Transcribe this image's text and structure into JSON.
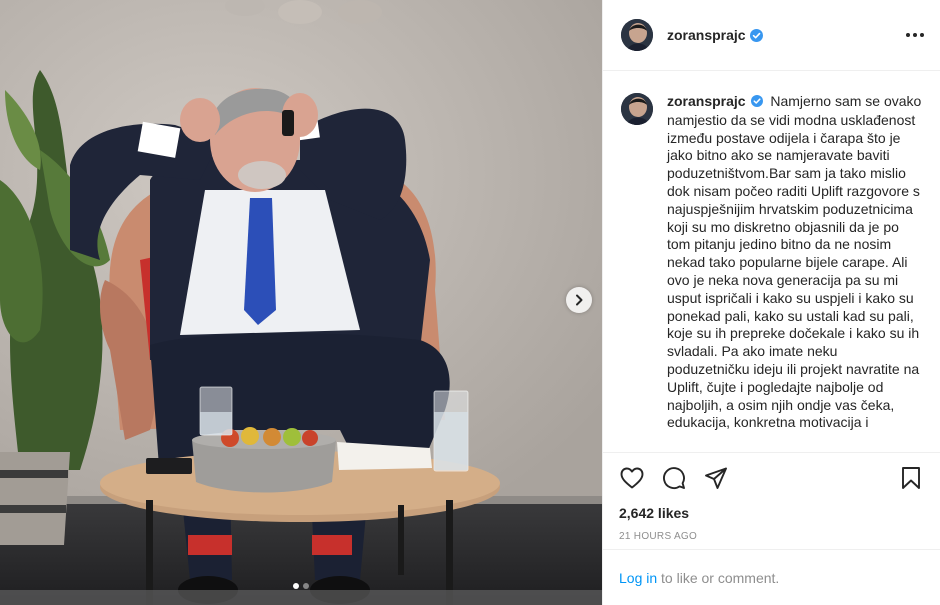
{
  "post": {
    "username": "zoransprajc",
    "verified": true,
    "caption": "Namjerno sam se ovako namjestio da se vidi modna usklađenost između postave odijela i čarapa što je jako bitno ako se namjeravate baviti poduzetništvom.Bar sam ja tako mislio dok nisam počeo raditi Uplift razgovore s najuspješnijim hrvatskim poduzetnicima koji su mo diskretno objasnili da je po tom pitanju jedino bitno da ne nosim nekad tako popularne bijele carape. Ali ovo je neka nova generacija pa su mi usput ispričali i kako su uspjeli i kako su ponekad pali, kako su ustali kad su pali, koje su ih prepreke dočekale i kako su ih svladali. Pa ako imate neku poduzetničku ideju ili projekt navratite na Uplift, čujte i pogledajte najbolje od najboljih, a osim njih ondje vas čeka, edukacija, konkretna motivacija i",
    "likes": "2,642 likes",
    "time": "21 HOURS AGO",
    "login_link": "Log in",
    "login_suffix": " to like or comment."
  },
  "carousel": {
    "slide_count": 2,
    "active_index": 0
  },
  "icons": {
    "more": "more-options-icon",
    "verified": "verified-badge-icon",
    "like": "heart-icon",
    "comment": "comment-icon",
    "share": "paper-plane-icon",
    "save": "bookmark-icon",
    "next": "chevron-right-icon"
  },
  "colors": {
    "verified": "#3897f0",
    "link": "#0095f6",
    "muted": "#8e8e8e",
    "text": "#262626"
  }
}
